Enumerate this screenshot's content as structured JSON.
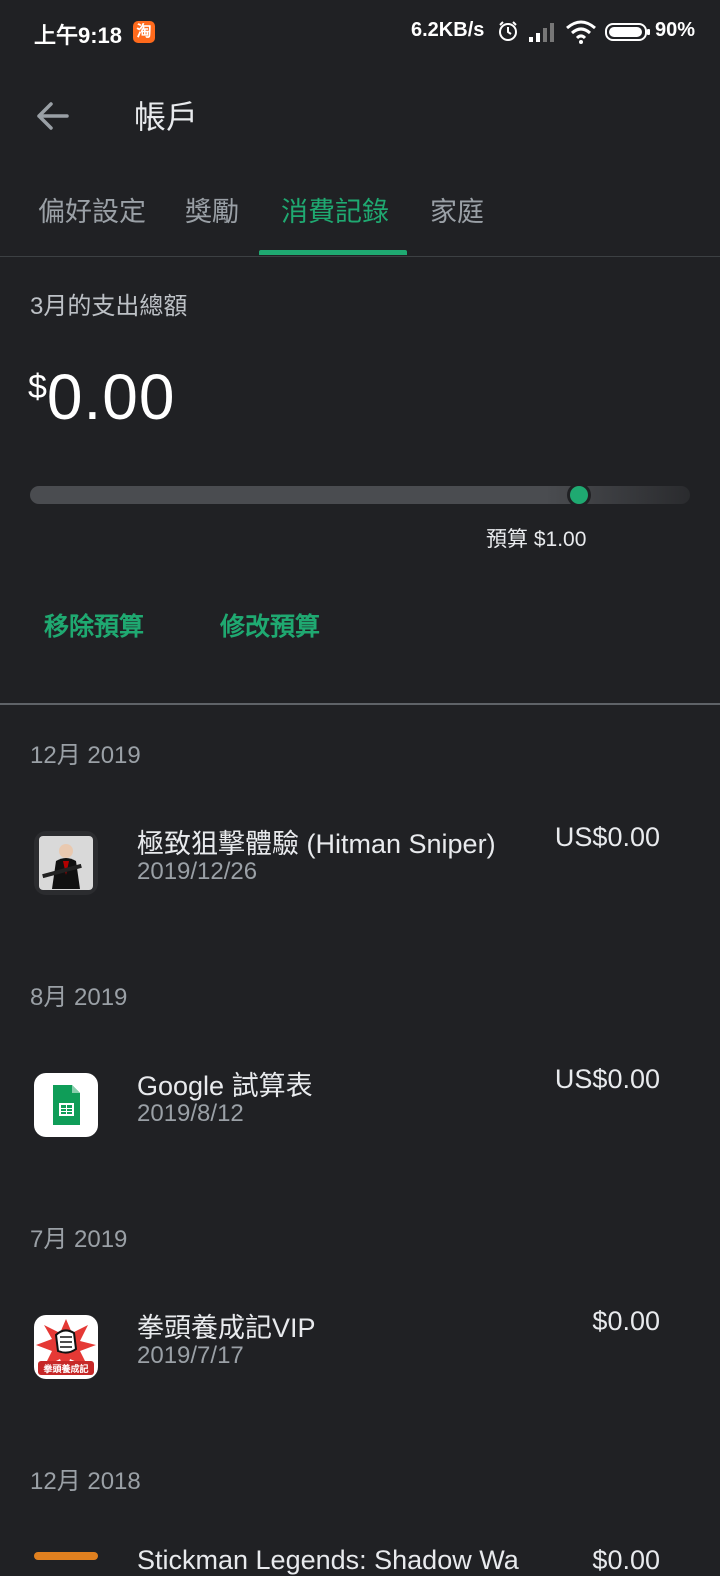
{
  "status_bar": {
    "time": "上午9:18",
    "taobao_badge": "淘",
    "net_speed": "6.2KB/s",
    "battery": "90%",
    "icons": [
      "alarm-icon",
      "signal-icon",
      "wifi-icon",
      "battery-icon"
    ]
  },
  "app_bar": {
    "title": "帳戶",
    "back_icon": "arrow-left-icon"
  },
  "tabs": [
    {
      "label": "偏好設定",
      "active": false
    },
    {
      "label": "獎勵",
      "active": false
    },
    {
      "label": "消費記錄",
      "active": true
    },
    {
      "label": "家庭",
      "active": false
    }
  ],
  "budget": {
    "month_label": "3月的支出總額",
    "currency": "$",
    "amount": "0.00",
    "budget_label": "預算 $1.00",
    "remove_label": "移除預算",
    "edit_label": "修改預算"
  },
  "history": [
    {
      "section": "12月 2019",
      "items": [
        {
          "name": "極致狙擊體驗 (Hitman Sniper)",
          "date": "2019/12/26",
          "price": "US$0.00",
          "icon": "hitman-sniper-app-icon"
        }
      ]
    },
    {
      "section": "8月 2019",
      "items": [
        {
          "name": "Google 試算表",
          "date": "2019/8/12",
          "price": "US$0.00",
          "icon": "google-sheets-app-icon"
        }
      ]
    },
    {
      "section": "7月 2019",
      "items": [
        {
          "name": "拳頭養成記VIP",
          "date": "2019/7/17",
          "price": "$0.00",
          "icon": "fist-app-icon",
          "icon_text": "拳頭養成記"
        }
      ]
    },
    {
      "section": "12月 2018",
      "items": [
        {
          "name": "Stickman Legends: Shadow Wa",
          "date": "",
          "price": "$0.00",
          "icon": "stickman-app-icon"
        }
      ]
    }
  ],
  "colors": {
    "background": "#202124",
    "accent": "#1fa971",
    "text": "#e8eaed",
    "muted": "#9aa0a6"
  }
}
